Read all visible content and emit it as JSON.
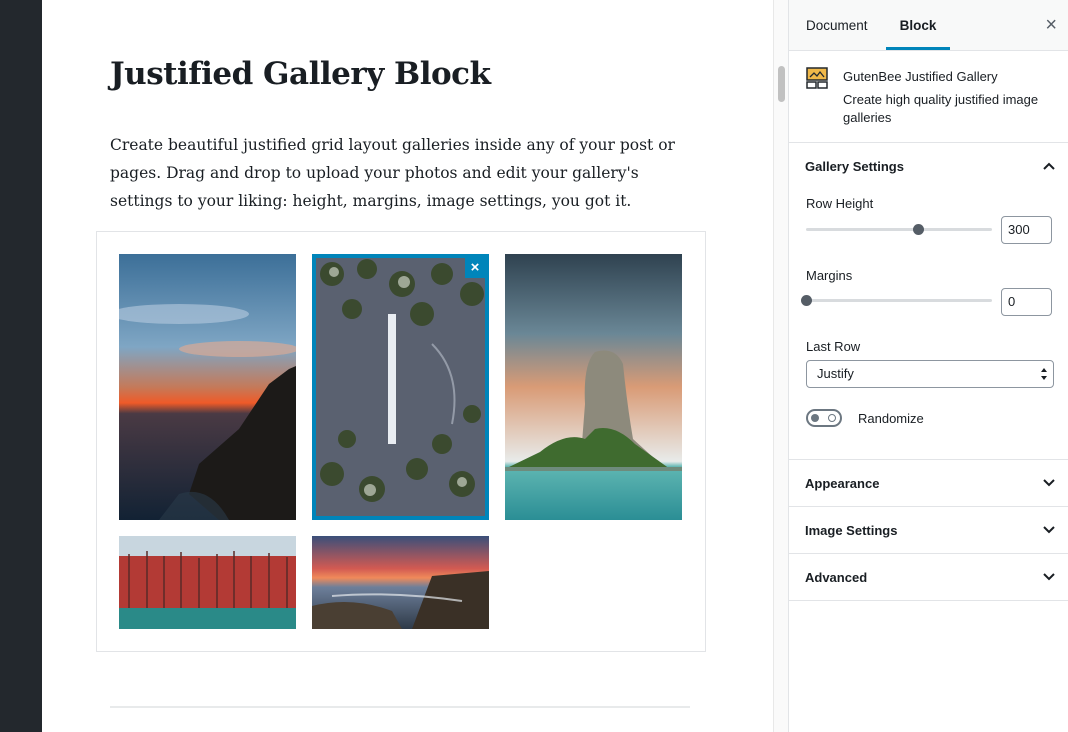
{
  "post": {
    "title": "Justified Gallery Block",
    "paragraph": "Create beautiful justified grid layout galleries inside any of your post or pages. Drag and drop to upload your photos and edit your gallery's settings to your liking: height, margins, image settings, you got it."
  },
  "gallery": {
    "images": [
      {
        "name": "sunset-coast",
        "selected": false
      },
      {
        "name": "frozen-forest-aerial",
        "selected": true
      },
      {
        "name": "rock-island",
        "selected": false
      },
      {
        "name": "red-trees",
        "selected": false
      },
      {
        "name": "sunset-sea-rocks",
        "selected": false
      }
    ],
    "remove_glyph": "×"
  },
  "sidebar": {
    "tabs": {
      "document": "Document",
      "block": "Block"
    },
    "active_tab": "Block",
    "close_glyph": "×",
    "block": {
      "name": "GutenBee Justified Gallery",
      "description": "Create high quality justified image galleries"
    },
    "gallery_settings": {
      "title": "Gallery Settings",
      "expanded": true,
      "row_height": {
        "label": "Row Height",
        "value": "300",
        "min": 0,
        "max": 500
      },
      "margins": {
        "label": "Margins",
        "value": "0",
        "min": 0,
        "max": 100
      },
      "last_row": {
        "label": "Last Row",
        "value": "Justify"
      },
      "randomize": {
        "label": "Randomize",
        "checked": false
      }
    },
    "panels": [
      {
        "title": "Appearance",
        "expanded": false
      },
      {
        "title": "Image Settings",
        "expanded": false
      },
      {
        "title": "Advanced",
        "expanded": false
      }
    ]
  },
  "colors": {
    "accent": "#0085ba",
    "admin_bar": "#23282d",
    "block_icon": "#f0b849"
  }
}
